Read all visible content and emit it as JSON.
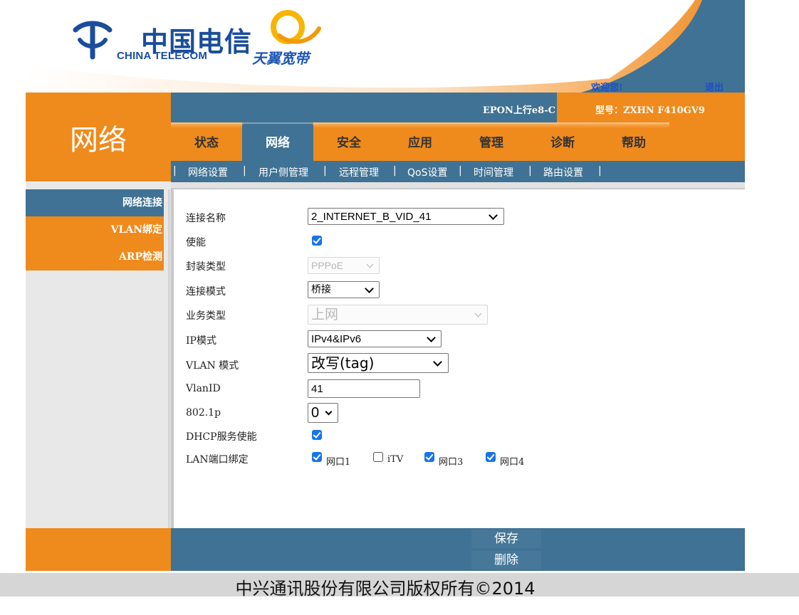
{
  "header": {
    "brand_cn": "中国电信",
    "brand_en": "CHINA TELECOM",
    "brand2": "天翼宽带",
    "welcome": "欢迎您!",
    "logout": "退出"
  },
  "section_title": "网络",
  "info_bar": {
    "device_type": "EPON上行e8-C",
    "model": "型号：ZXHN F410GV9"
  },
  "tabs": [
    {
      "label": "状态"
    },
    {
      "label": "网络",
      "active": true
    },
    {
      "label": "安全"
    },
    {
      "label": "应用"
    },
    {
      "label": "管理"
    },
    {
      "label": "诊断"
    },
    {
      "label": "帮助"
    }
  ],
  "subnav": [
    {
      "label": "网络设置"
    },
    {
      "label": "用户侧管理"
    },
    {
      "label": "远程管理"
    },
    {
      "label": "QoS设置"
    },
    {
      "label": "时间管理"
    },
    {
      "label": "路由设置"
    }
  ],
  "sidebar": [
    {
      "label": "网络连接",
      "active": true
    },
    {
      "label": "VLAN绑定"
    },
    {
      "label": "ARP检测"
    }
  ],
  "form": {
    "connection_name": {
      "label": "连接名称",
      "value": "2_INTERNET_B_VID_41"
    },
    "enable": {
      "label": "使能",
      "checked": true
    },
    "encapsulation": {
      "label": "封装类型",
      "value": "PPPoE",
      "disabled": true
    },
    "connection_mode": {
      "label": "连接模式",
      "value": "桥接"
    },
    "service_type": {
      "label": "业务类型",
      "value": "上网",
      "disabled": true
    },
    "ip_mode": {
      "label": "IP模式",
      "value": "IPv4&IPv6"
    },
    "vlan_mode": {
      "label": "VLAN 模式",
      "value": "改写(tag)"
    },
    "vlan_id": {
      "label": "VlanID",
      "value": "41"
    },
    "dot1p": {
      "label": "802.1p",
      "value": "0"
    },
    "dhcp_enable": {
      "label": "DHCP服务使能",
      "checked": true
    },
    "lan_binding": {
      "label": "LAN端口绑定",
      "ports": [
        {
          "label": "网口1",
          "checked": true
        },
        {
          "label": "iTV",
          "checked": false
        },
        {
          "label": "网口3",
          "checked": true
        },
        {
          "label": "网口4",
          "checked": true
        }
      ]
    }
  },
  "buttons": {
    "save": "保存",
    "delete": "删除"
  },
  "footer": "中兴通讯股份有限公司版权所有©2014",
  "colors": {
    "orange": "#ef8a1c",
    "blue": "#3f7294",
    "checkbox": "#1874e8"
  }
}
